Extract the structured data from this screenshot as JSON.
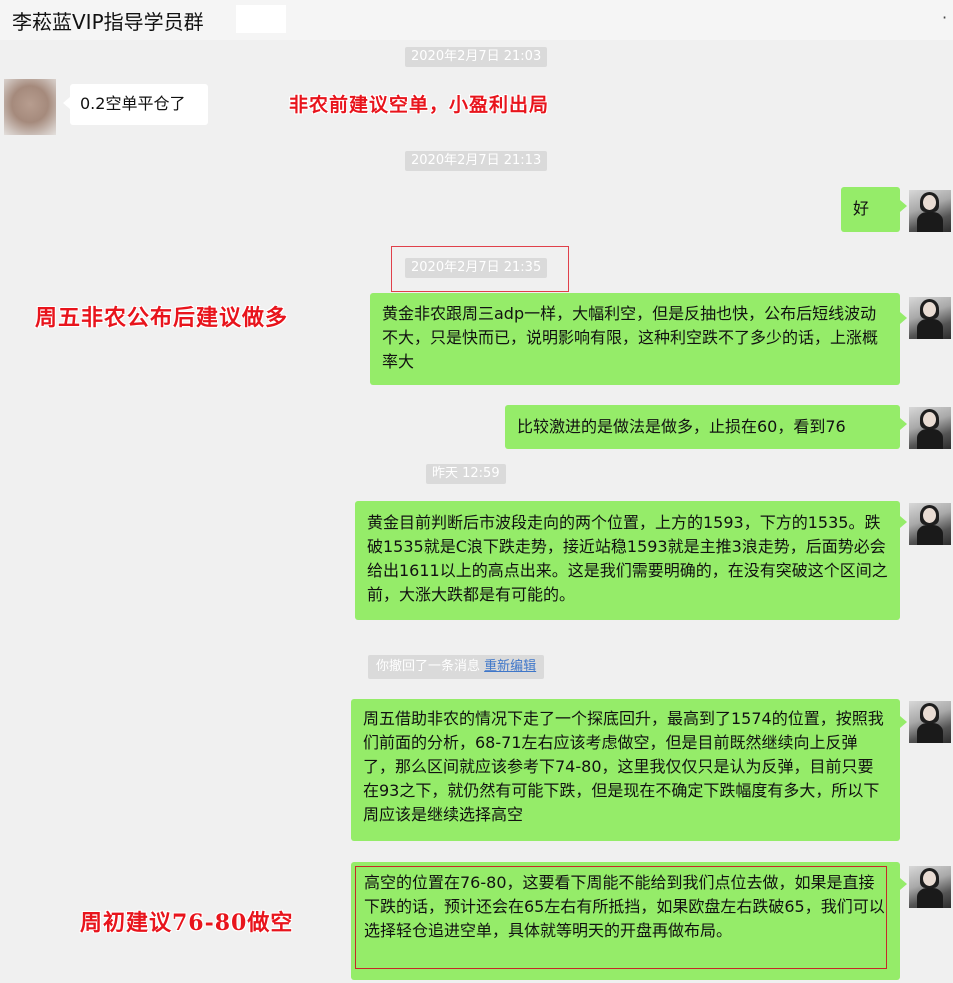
{
  "header": {
    "title": "李菘蓝VIP指导学员群",
    "more_glyph": "·"
  },
  "timestamps": [
    "2020年2月7日 21:03",
    "2020年2月7日 21:13",
    "2020年2月7日 21:35",
    "昨天 12:59"
  ],
  "messages": [
    {
      "side": "left",
      "text": "0.2空单平仓了"
    },
    {
      "side": "right",
      "text": "好"
    },
    {
      "side": "right",
      "text": "黄金非农跟周三adp一样，大幅利空，但是反抽也快，公布后短线波动不大，只是快而已，说明影响有限，这种利空跌不了多少的话，上涨概率大"
    },
    {
      "side": "right",
      "text": "比较激进的是做法是做多，止损在60，看到76"
    },
    {
      "side": "right",
      "text": "黄金目前判断后市波段走向的两个位置，上方的1593，下方的1535。跌破1535就是C浪下跌走势，接近站稳1593就是主推3浪走势，后面势必会给出1611以上的高点出来。这是我们需要明确的，在没有突破这个区间之前，大涨大跌都是有可能的。"
    },
    {
      "side": "right",
      "text": "周五借助非农的情况下走了一个探底回升，最高到了1574的位置，按照我们前面的分析，68-71左右应该考虑做空，但是目前既然继续向上反弹了，那么区间就应该参考下74-80，这里我仅仅只是认为反弹，目前只要在93之下，就仍然有可能下跌，但是现在不确定下跌幅度有多大，所以下周应该是继续选择高空"
    },
    {
      "side": "right",
      "text": "高空的位置在76-80，这要看下周能不能给到我们点位去做，如果是直接下跌的话，预计还会在65左右有所抵挡，如果欧盘左右跌破65，我们可以选择轻仓追进空单，具体就等明天的开盘再做布局。"
    }
  ],
  "recall": {
    "text": "你撤回了一条消息",
    "link": "重新编辑"
  },
  "annotations": [
    "非农前建议空单，小盈利出局",
    "周五非农公布后建议做多",
    "周初建议76-80做空"
  ],
  "colors": {
    "bubble_green": "#95ec69",
    "annotation_red": "#e8141c",
    "background": "#f0f0f0"
  }
}
